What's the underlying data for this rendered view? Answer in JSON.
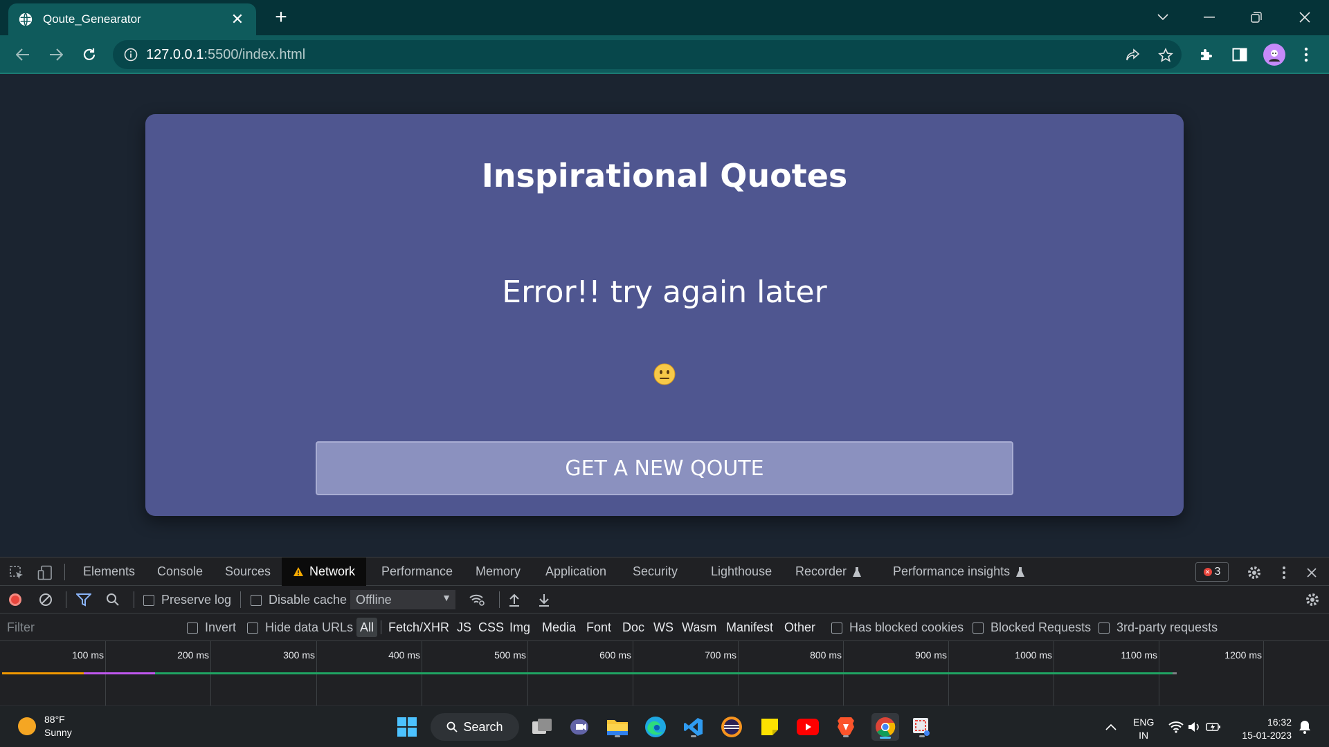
{
  "browser": {
    "tab_title": "Qoute_Genearator",
    "url_host": "127.0.0.1",
    "url_path": ":5500/index.html"
  },
  "page": {
    "heading": "Inspirational Quotes",
    "quote": "Error!! try again later",
    "emoji": "neutral-face-emoji",
    "button_label": "GET A NEW QOUTE"
  },
  "devtools": {
    "tabs": [
      "Elements",
      "Console",
      "Sources",
      "Network",
      "Performance",
      "Memory",
      "Application",
      "Security",
      "Lighthouse",
      "Recorder",
      "Performance insights"
    ],
    "error_count": "3",
    "preserve_log": "Preserve log",
    "disable_cache": "Disable cache",
    "throttling": "Offline",
    "filter_placeholder": "Filter",
    "invert": "Invert",
    "hide_data_urls": "Hide data URLs",
    "filter_types": [
      "All",
      "Fetch/XHR",
      "JS",
      "CSS",
      "Img",
      "Media",
      "Font",
      "Doc",
      "WS",
      "Wasm",
      "Manifest",
      "Other"
    ],
    "has_blocked_cookies": "Has blocked cookies",
    "blocked_requests": "Blocked Requests",
    "third_party": "3rd-party requests",
    "timeline_ticks": [
      "100 ms",
      "200 ms",
      "300 ms",
      "400 ms",
      "500 ms",
      "600 ms",
      "700 ms",
      "800 ms",
      "900 ms",
      "1000 ms",
      "1100 ms",
      "1200 ms"
    ]
  },
  "taskbar": {
    "temperature": "88°F",
    "weather": "Sunny",
    "search_label": "Search",
    "lang_1": "ENG",
    "lang_2": "IN",
    "time": "16:32",
    "date": "15-01-2023"
  },
  "colors": {
    "card": "#4f5690",
    "button": "#8b91bf",
    "chrome_tab": "#0f5b5c",
    "page_bg": "#1b2430"
  }
}
